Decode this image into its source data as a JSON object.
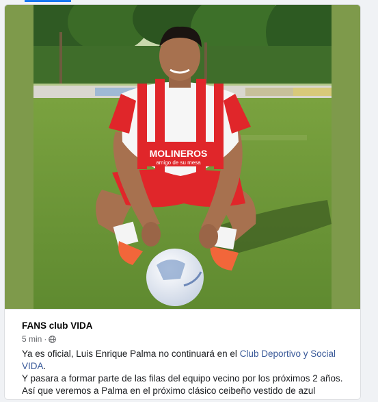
{
  "post": {
    "author": "FANS club VIDA",
    "time": "5 min",
    "separator": "·",
    "privacy_icon": "globe-icon",
    "line1_before": "Ya es oficial, Luis Enrique Palma no continuará en el ",
    "line1_link": "Club Deportivo y Social VIDA",
    "line1_after": ".",
    "line2": "Y pasara a formar parte de las filas del equipo vecino por los próximos 2 años.",
    "line3": "Así que veremos a Palma en el próximo clásico ceibeño vestido de azul"
  },
  "jersey": {
    "sponsor_text": "MOLINEROS",
    "sponsor_sub": "amigo de su mesa"
  },
  "colors": {
    "link": "#385898",
    "jersey_red": "#e0262a",
    "grass": "#6f9a3a"
  }
}
